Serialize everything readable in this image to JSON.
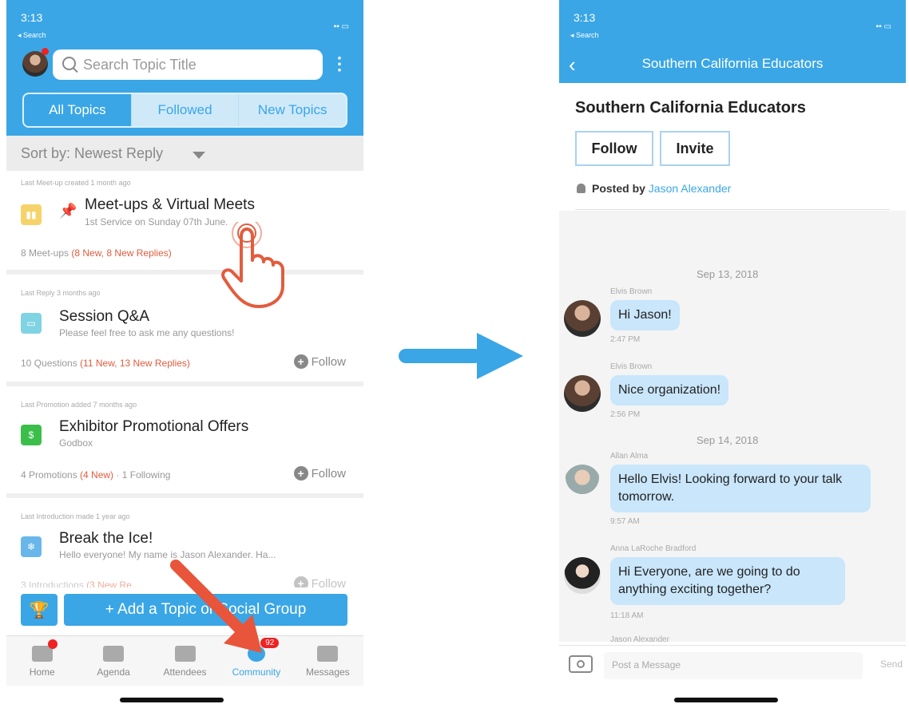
{
  "colors": {
    "brand_blue": "#3aa6e6",
    "accent_red": "#e25c3e",
    "bubble": "#c9e6fb"
  },
  "left": {
    "status": {
      "time": "3:13",
      "back_app": "◂ Search"
    },
    "search": {
      "placeholder": "Search Topic Title"
    },
    "segments": [
      "All Topics",
      "Followed",
      "New Topics"
    ],
    "sort_label": "Sort by: Newest Reply",
    "topics": [
      {
        "meta": "Last Meet-up created 1 month ago",
        "title": "Meet-ups & Virtual Meets",
        "subtitle": "1st Service on Sunday 07th June.",
        "count": "8 Meet-ups",
        "highlight": "(8 New, 8 New Replies)",
        "icon": "meetup-icon",
        "pinned": true
      },
      {
        "meta": "Last Reply 3 months ago",
        "title": "Session Q&A",
        "subtitle": "Please feel free to ask me any questions!",
        "count": "10 Questions",
        "highlight": "(11 New, 13 New Replies)",
        "icon": "chat-bubble-icon",
        "follow": "Follow"
      },
      {
        "meta": "Last Promotion added 7 months ago",
        "title": "Exhibitor Promotional Offers",
        "subtitle": "Godbox",
        "count": "4 Promotions",
        "highlight": "(4 New)",
        "extra": "· 1 Following",
        "icon": "promo-icon",
        "follow": "Follow"
      },
      {
        "meta": "Last Introduction made 1 year ago",
        "title": "Break the Ice!",
        "subtitle": "Hello everyone! My name is Jason Alexander. Ha...",
        "count": "3 Introductions",
        "highlight": "(3 New Re...",
        "icon": "ice-icon",
        "follow": "Follow"
      }
    ],
    "add_button": "+ Add a Topic or Social Group",
    "tabs": [
      {
        "label": "Home",
        "icon": "home-icon"
      },
      {
        "label": "Agenda",
        "icon": "agenda-icon"
      },
      {
        "label": "Attendees",
        "icon": "attendees-icon"
      },
      {
        "label": "Community",
        "icon": "community-icon",
        "badge": "92"
      },
      {
        "label": "Messages",
        "icon": "messages-icon"
      }
    ]
  },
  "right": {
    "status": {
      "time": "3:13",
      "back_app": "◂ Search"
    },
    "nav_title": "Southern California Educators",
    "group_title": "Southern California Educators",
    "follow_label": "Follow",
    "invite_label": "Invite",
    "posted_by_label": "Posted by",
    "posted_by_name": "Jason Alexander",
    "dates": [
      "Sep 13, 2018",
      "Sep 14, 2018"
    ],
    "messages": [
      {
        "sender": "Elvis Brown",
        "text": "Hi Jason!",
        "time": "2:47 PM"
      },
      {
        "sender": "Elvis Brown",
        "text": "Nice organization!",
        "time": "2:56 PM"
      },
      {
        "sender": "Allan Alma",
        "text": "Hello Elvis! Looking forward to your talk tomorrow.",
        "time": "9:57 AM"
      },
      {
        "sender": "Anna LaRoche Bradford",
        "text": "Hi Everyone, are we going to do anything exciting together?",
        "time": "11:18 AM"
      },
      {
        "sender": "Jason Alexander"
      }
    ],
    "composer_placeholder": "Post a Message",
    "send_label": "Send"
  }
}
